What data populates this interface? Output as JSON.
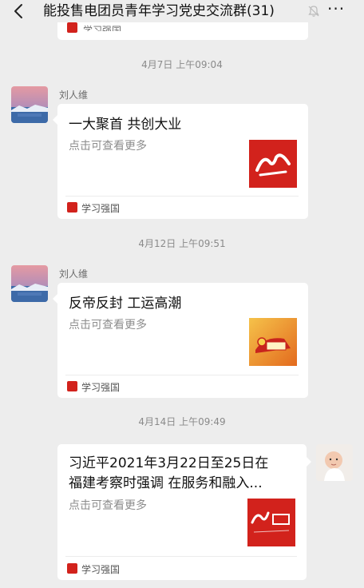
{
  "header": {
    "title": "能投售电团员青年学习党史交流群(31)",
    "back_icon": "chevron-left-icon",
    "mute_icon": "bell-muted-icon",
    "more_label": "···"
  },
  "messages": [
    {
      "timestamp": "4月7日 上午09:04",
      "sender": "刘人维",
      "side": "left",
      "title": "一大聚首 共创大业",
      "desc": "点击可查看更多",
      "source": "学习强国",
      "thumb": "xuexi-red-logo"
    },
    {
      "timestamp": "4月12日 上午09:51",
      "sender": "刘人维",
      "side": "left",
      "title": "反帝反封 工运高潮",
      "desc": "点击可查看更多",
      "source": "学习强国",
      "thumb": "party-emblem-100-image"
    },
    {
      "timestamp": "4月14日 上午09:49",
      "sender": "",
      "side": "right",
      "title_line1": "习近平2021年3月22日至25日在",
      "title_line2": "福建考察时强调 在服务和融入...",
      "desc": "点击可查看更多",
      "source": "学习强国",
      "thumb": "xuexi-qiangguo-logo"
    }
  ],
  "partial_top_card": {
    "source": "学习强国"
  },
  "colors": {
    "background": "#ededed",
    "card": "#ffffff",
    "xuexi_red": "#d2221c"
  }
}
